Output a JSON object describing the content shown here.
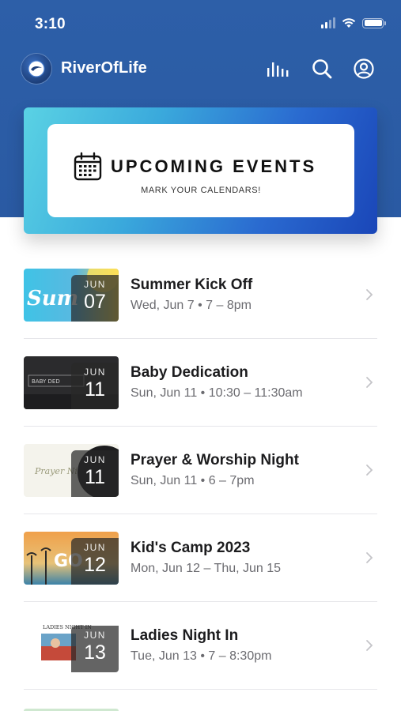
{
  "status_bar": {
    "time": "3:10"
  },
  "header": {
    "app_name": "RiverOfLife"
  },
  "banner": {
    "title": "UPCOMING EVENTS",
    "subtitle": "MARK YOUR CALENDARS!"
  },
  "events": [
    {
      "title": "Summer Kick Off",
      "time": "Wed, Jun 7 • 7 – 8pm",
      "month": "JUN",
      "day": "07",
      "thumb_text": "Sum"
    },
    {
      "title": "Baby Dedication",
      "time": "Sun, Jun 11 • 10:30 – 11:30am",
      "month": "JUN",
      "day": "11",
      "thumb_text": "BABY DED"
    },
    {
      "title": "Prayer & Worship Night",
      "time": "Sun, Jun 11 • 6 – 7pm",
      "month": "JUN",
      "day": "11",
      "thumb_text": "Prayer Night"
    },
    {
      "title": "Kid's Camp 2023",
      "time": "Mon, Jun 12 – Thu, Jun 15",
      "month": "JUN",
      "day": "12",
      "thumb_text": "GO"
    },
    {
      "title": "Ladies Night In",
      "time": "Tue, Jun 13 • 7 – 8:30pm",
      "month": "JUN",
      "day": "13",
      "thumb_text": "LADIES NIGHT IN"
    }
  ],
  "colors": {
    "header_blue": "#2d5fa8",
    "banner_start": "#5ad2e4",
    "banner_end": "#1a46b8"
  }
}
